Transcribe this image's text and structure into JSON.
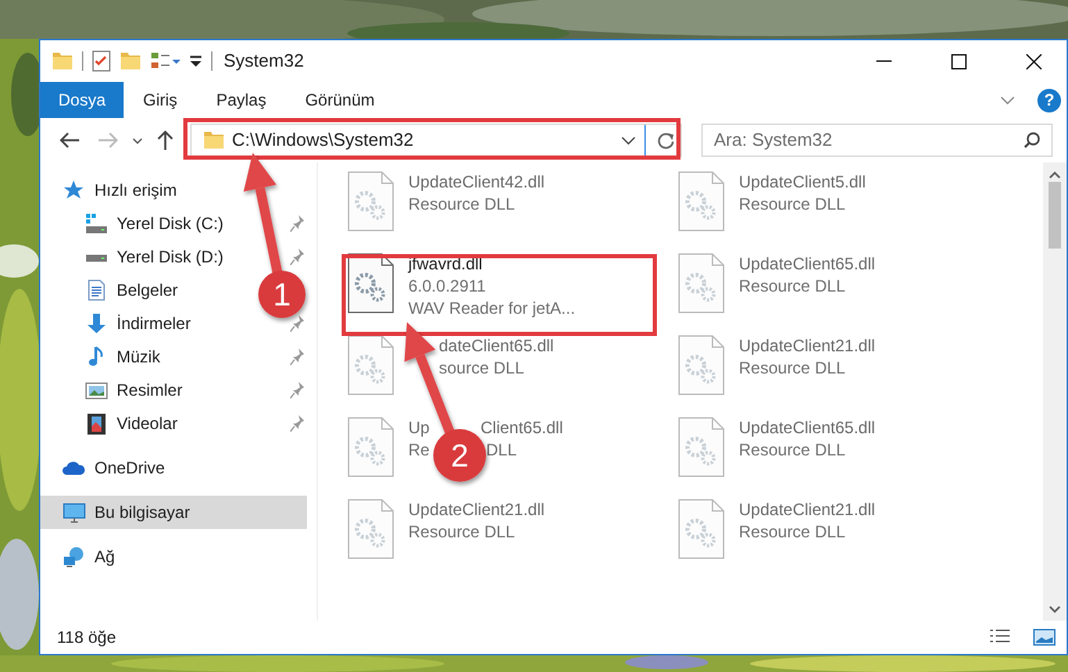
{
  "window": {
    "title": "System32"
  },
  "ribbon": {
    "tabs": [
      {
        "label": "Dosya",
        "selected": true
      },
      {
        "label": "Giriş",
        "selected": false
      },
      {
        "label": "Paylaş",
        "selected": false
      },
      {
        "label": "Görünüm",
        "selected": false
      }
    ],
    "help": "?"
  },
  "address": {
    "path": "C:\\Windows\\System32"
  },
  "search": {
    "placeholder": "Ara: System32"
  },
  "nav": [
    {
      "label": "Hızlı erişim",
      "kind": "star",
      "pinned": false,
      "selected": false,
      "children": [
        {
          "label": "Yerel Disk (C:)",
          "kind": "windrive",
          "pinned": true,
          "selected": false
        },
        {
          "label": "Yerel Disk (D:)",
          "kind": "drive",
          "pinned": true,
          "selected": false
        },
        {
          "label": "Belgeler",
          "kind": "docs",
          "pinned": false,
          "selected": false
        },
        {
          "label": "İndirmeler",
          "kind": "download",
          "pinned": true,
          "selected": false
        },
        {
          "label": "Müzik",
          "kind": "music",
          "pinned": true,
          "selected": false
        },
        {
          "label": "Resimler",
          "kind": "pictures",
          "pinned": true,
          "selected": false
        },
        {
          "label": "Videolar",
          "kind": "videos",
          "pinned": true,
          "selected": false
        }
      ]
    },
    {
      "label": "OneDrive",
      "kind": "cloud",
      "pinned": false,
      "selected": false
    },
    {
      "label": "Bu bilgisayar",
      "kind": "pc",
      "pinned": false,
      "selected": true
    },
    {
      "label": "Ağ",
      "kind": "network",
      "pinned": false,
      "selected": false
    }
  ],
  "files": [
    {
      "kind": "full",
      "name": [
        "UpdateClient42.dll"
      ],
      "lines": [
        [
          "Resource DLL"
        ]
      ],
      "dimmed": true
    },
    {
      "kind": "full",
      "name": [
        "UpdateClient5.dll"
      ],
      "lines": [
        [
          "Resource DLL"
        ]
      ],
      "dimmed": true
    },
    {
      "kind": "full",
      "name": [
        "jfwavrd.dll"
      ],
      "lines": [
        [
          "6.0.0.2911"
        ],
        [
          "WAV Reader for jetA..."
        ]
      ],
      "dimmed": false
    },
    {
      "kind": "full",
      "name": [
        "UpdateClient65.dll"
      ],
      "lines": [
        [
          "Resource DLL"
        ]
      ],
      "dimmed": true
    },
    {
      "kind": "lead_hidden",
      "name": [
        "dateClient65.dll"
      ],
      "lines": [
        [
          "source DLL"
        ]
      ],
      "dimmed": true
    },
    {
      "kind": "full",
      "name": [
        "UpdateClient21.dll"
      ],
      "lines": [
        [
          "Resource DLL"
        ]
      ],
      "dimmed": true
    },
    {
      "kind": "mid_hidden",
      "name": [
        "Up",
        "Client65.dll"
      ],
      "lines": [
        [
          "Re",
          "DLL"
        ]
      ],
      "dimmed": true
    },
    {
      "kind": "full",
      "name": [
        "UpdateClient65.dll"
      ],
      "lines": [
        [
          "Resource DLL"
        ]
      ],
      "dimmed": true
    },
    {
      "kind": "full",
      "name": [
        "UpdateClient21.dll"
      ],
      "lines": [
        [
          "Resource DLL"
        ]
      ],
      "dimmed": true
    },
    {
      "kind": "full",
      "name": [
        "UpdateClient21.dll"
      ],
      "lines": [
        [
          "Resource DLL"
        ]
      ],
      "dimmed": true
    }
  ],
  "status_bar": {
    "count": "118 öğe"
  },
  "callouts": [
    {
      "number": "1"
    },
    {
      "number": "2"
    }
  ]
}
